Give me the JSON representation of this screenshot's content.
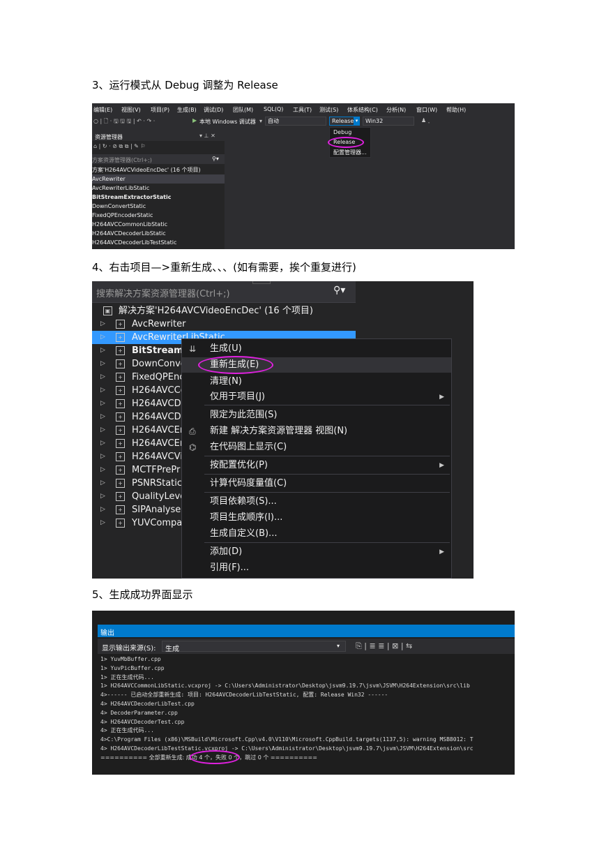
{
  "steps": {
    "s3": "3、运行模式从 Debug 调整为 Release",
    "s4": "4、右击项目—>重新生成、、、(如有需要，挨个重复进行)",
    "s5": "5、生成成功界面显示"
  },
  "shot1": {
    "menu": [
      "编辑(E)",
      "视图(V)",
      "项目(P)",
      "生成(B)",
      "调试(D)",
      "团队(M)",
      "SQL(Q)",
      "工具(T)",
      "测试(S)",
      "体系结构(C)",
      "分析(N)",
      "窗口(W)",
      "帮助(H)"
    ],
    "toolbar": {
      "run_label": "本地 Windows 调试器",
      "auto_combo": "自动",
      "config_combo": "Release",
      "platform_combo": "Win32"
    },
    "dropdown": [
      "Debug",
      "Release",
      "配置管理器..."
    ],
    "panel_title": "资源管理器",
    "search_placeholder": "方案资源管理器(Ctrl+;)",
    "solution": "方案'H264AVCVideoEncDec' (16 个项目)",
    "projects": [
      "AvcRewriter",
      "AvcRewriterLibStatic",
      "BitStreamExtractorStatic",
      "DownConvertStatic",
      "FixedQPEncoderStatic",
      "H264AVCCommonLibStatic",
      "H264AVCDecoderLibStatic",
      "H264AVCDecoderLibTestStatic"
    ]
  },
  "shot2": {
    "search_placeholder": "搜索解决方案资源管理器(Ctrl+;)",
    "solution": "解决方案'H264AVCVideoEncDec' (16 个项目)",
    "projects": [
      "AvcRewriter",
      "AvcRewriterLibStatic",
      "BitStreamE",
      "DownConve",
      "FixedQPEnc",
      "H264AVCCo",
      "H264AVCDe",
      "H264AVCDe",
      "H264AVCEr",
      "H264AVCEr",
      "H264AVCVi",
      "MCTFPrePr",
      "PSNRStatic",
      "QualityLeve",
      "SIPAnalyser",
      "YUVCompa"
    ],
    "context_menu": [
      "生成(U)",
      "重新生成(E)",
      "清理(N)",
      "仅用于项目(J)",
      "限定为此范围(S)",
      "新建 解决方案资源管理器 视图(N)",
      "在代码图上显示(C)",
      "按配置优化(P)",
      "计算代码度量值(C)",
      "项目依赖项(S)...",
      "项目生成顺序(I)...",
      "生成自定义(B)...",
      "添加(D)",
      "引用(F)..."
    ]
  },
  "shot3": {
    "title": "输出",
    "source_label": "显示输出来源(S):",
    "source_value": "生成",
    "lines": [
      "1>  YuvMbBuffer.cpp",
      "1>  YuvPicBuffer.cpp",
      "1>  正在生成代码...",
      "1>  H264AVCCommonLibStatic.vcxproj -> C:\\Users\\Administrator\\Desktop\\jsvm9.19.7\\jsvm\\JSVM\\H264Extension\\src\\lib",
      "4>------ 已启动全部重新生成: 项目: H264AVCDecoderLibTestStatic, 配置: Release Win32 ------",
      "4>  H264AVCDecoderLibTest.cpp",
      "4>  DecoderParameter.cpp",
      "4>  H264AVCDecoderTest.cpp",
      "4>  正在生成代码...",
      "4>C:\\Program Files (x86)\\MSBuild\\Microsoft.Cpp\\v4.0\\V110\\Microsoft.CppBuild.targets(1137,5): warning MSB8012: T",
      "4>  H264AVCDecoderLibTestStatic.vcxproj -> C:\\Users\\Administrator\\Desktop\\jsvm9.19.7\\jsvm\\JSVM\\H264Extension\\src",
      "========== 全部重新生成: 成功 4 个，失败 0 个，跳过 0 个 =========="
    ]
  }
}
